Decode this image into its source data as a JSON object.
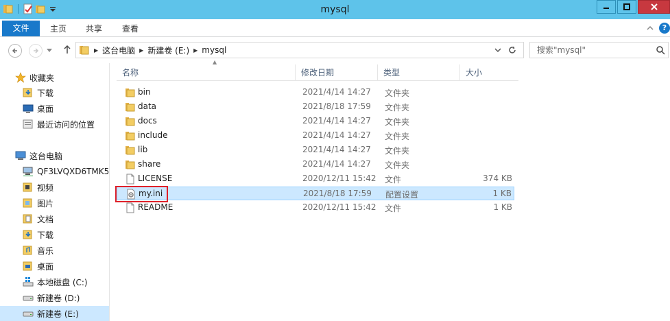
{
  "window": {
    "title": "mysql"
  },
  "ribbon": {
    "tabs": [
      "文件",
      "主页",
      "共享",
      "查看"
    ]
  },
  "address": {
    "crumbs": [
      "这台电脑",
      "新建卷 (E:)",
      "mysql"
    ]
  },
  "search": {
    "placeholder": "搜索\"mysql\""
  },
  "navpane": {
    "quick_access_label": "收藏夹",
    "quick_items": [
      "下载",
      "桌面",
      "最近访问的位置"
    ],
    "this_pc_label": "这台电脑",
    "pc_items": [
      "QF3LVQXD6TMK5",
      "视频",
      "图片",
      "文档",
      "下载",
      "音乐",
      "桌面",
      "本地磁盘 (C:)",
      "新建卷 (D:)",
      "新建卷 (E:)"
    ]
  },
  "columns": {
    "name": "名称",
    "date": "修改日期",
    "type": "类型",
    "size": "大小"
  },
  "files": [
    {
      "name": "bin",
      "date": "2021/4/14 14:27",
      "type": "文件夹",
      "size": "",
      "icon": "folder-icon"
    },
    {
      "name": "data",
      "date": "2021/8/18 17:59",
      "type": "文件夹",
      "size": "",
      "icon": "folder-icon"
    },
    {
      "name": "docs",
      "date": "2021/4/14 14:27",
      "type": "文件夹",
      "size": "",
      "icon": "folder-icon"
    },
    {
      "name": "include",
      "date": "2021/4/14 14:27",
      "type": "文件夹",
      "size": "",
      "icon": "folder-icon"
    },
    {
      "name": "lib",
      "date": "2021/4/14 14:27",
      "type": "文件夹",
      "size": "",
      "icon": "folder-icon"
    },
    {
      "name": "share",
      "date": "2021/4/14 14:27",
      "type": "文件夹",
      "size": "",
      "icon": "folder-icon"
    },
    {
      "name": "LICENSE",
      "date": "2020/12/11 15:42",
      "type": "文件",
      "size": "374 KB",
      "icon": "file-icon"
    },
    {
      "name": "my.ini",
      "date": "2021/8/18 17:59",
      "type": "配置设置",
      "size": "1 KB",
      "icon": "settings-file-icon"
    },
    {
      "name": "README",
      "date": "2020/12/11 15:42",
      "type": "文件",
      "size": "1 KB",
      "icon": "file-icon"
    }
  ],
  "colors": {
    "titlebar": "#5ec3ea",
    "file_tab": "#1979ca",
    "selection": "#cce8ff",
    "highlight_border": "#e0212a"
  }
}
